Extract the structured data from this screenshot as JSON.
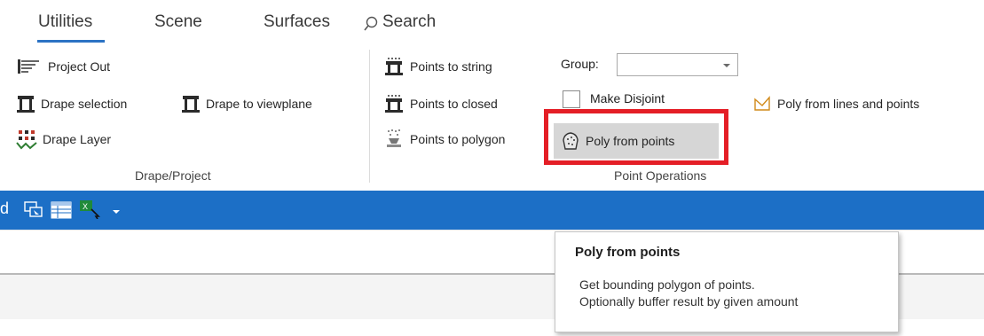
{
  "ribbon": {
    "tabs": [
      {
        "label": "Utilities",
        "active": true
      },
      {
        "label": "Scene",
        "active": false
      },
      {
        "label": "Surfaces",
        "active": false
      }
    ],
    "search_label": "Search",
    "groups": {
      "drape_project": {
        "label": "Drape/Project",
        "project_out": "Project Out",
        "drape_selection": "Drape selection",
        "drape_to_viewplane": "Drape to viewplane",
        "drape_layer": "Drape Layer"
      },
      "point_operations": {
        "label": "Point Operations",
        "points_to_string": "Points to string",
        "points_to_closed": "Points to closed",
        "points_to_polygon": "Points to  polygon",
        "group_label": "Group:",
        "group_value": "",
        "make_disjoint": "Make Disjoint",
        "make_disjoint_checked": false,
        "poly_from_points": "Poly from points",
        "poly_from_lines_and_points": "Poly from lines and points"
      }
    }
  },
  "quick_access": {
    "leading_text": "d"
  },
  "tooltip": {
    "title": "Poly from points",
    "line1": "Get bounding polygon of points.",
    "line2": "Optionally buffer result by given amount"
  },
  "colors": {
    "accent": "#2c73c4",
    "quick_bar": "#1c6fc6",
    "highlight_border": "#e41e26"
  }
}
